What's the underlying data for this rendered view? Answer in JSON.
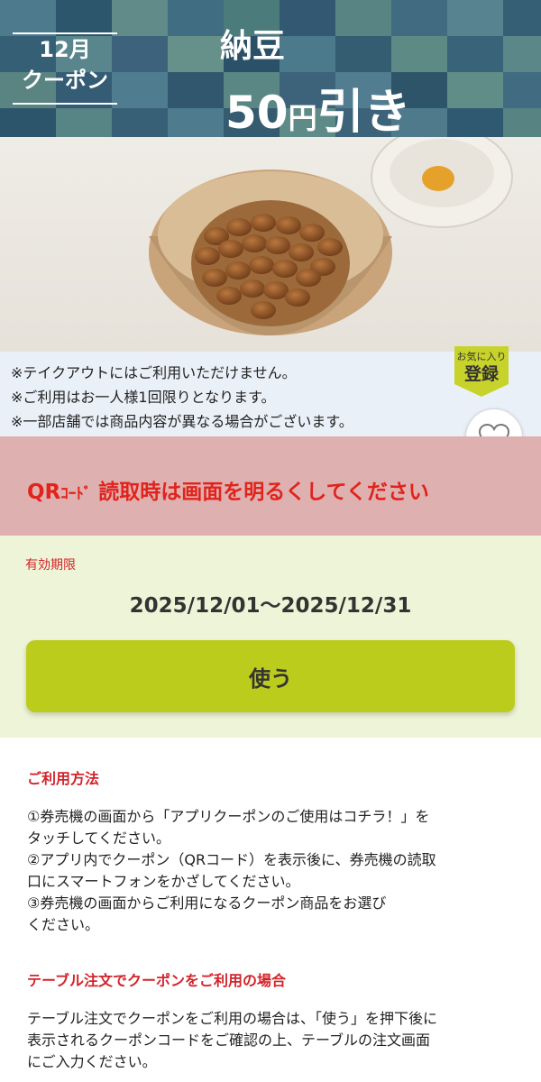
{
  "banner": {
    "month_label_line1": "12月",
    "month_label_line2": "クーポン",
    "product_name": "納豆",
    "discount_number": "50",
    "discount_yen": "円",
    "discount_suffix": "引き"
  },
  "notes": [
    "※テイクアウトにはご利用いただけません。",
    "※ご利用はお一人様1回限りとなります。",
    "※一部店舗では商品内容が異なる場合がございます。"
  ],
  "favorite": {
    "small_label": "お気に入り",
    "big_label": "登録",
    "icon": "heart-icon"
  },
  "alert": {
    "qr": "QR",
    "code": "ｺｰﾄﾞ",
    "message": "読取時は画面を明るくしてください"
  },
  "validity": {
    "label": "有効期限",
    "dates": "2025/12/01～2025/12/31"
  },
  "use_button": {
    "label": "使う"
  },
  "instructions": {
    "how_to_title": "ご利用方法",
    "how_to_lines": [
      "①券売機の画面から「アプリクーポンのご使用はコチラ！」を",
      "タッチしてください。",
      "②アプリ内でクーポン（QRコード）を表示後に、券売機の読取",
      "口にスマートフォンをかざしてください。",
      "③券売機の画面からご利用になるクーポン商品をお選び",
      "ください。"
    ],
    "table_order_title": "テーブル注文でクーポンをご利用の場合",
    "table_order_lines": [
      "テーブル注文でクーポンをご利用の場合は、「使う」を押下後に",
      "表示されるクーポンコードをご確認の上、テーブルの注文画面",
      "にご入力ください。"
    ]
  },
  "colors": {
    "banner_bg": "#3f6a83",
    "alert_bg": "#dfb0b0",
    "alert_text": "#e1231c",
    "validity_bg": "#eef4d7",
    "use_button": "#bccc1c",
    "section_title": "#d3242a"
  }
}
